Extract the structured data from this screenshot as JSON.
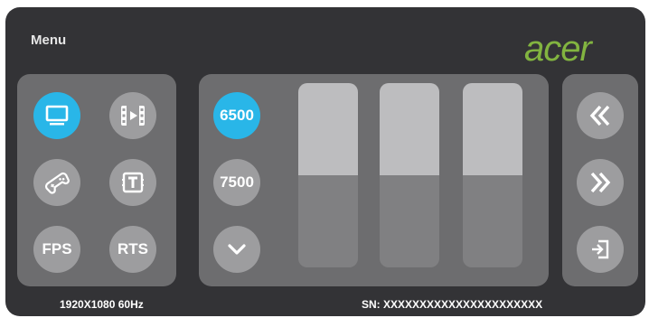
{
  "menu": {
    "title": "Menu",
    "logo": "acer"
  },
  "modes": {
    "items": [
      {
        "icon": "monitor-icon",
        "label": "",
        "active": true
      },
      {
        "icon": "movie-icon",
        "label": "",
        "active": false
      },
      {
        "icon": "gamepad-icon",
        "label": "",
        "active": false
      },
      {
        "icon": "text-mode-icon",
        "label": "",
        "active": false
      },
      {
        "icon": "",
        "label": "FPS",
        "active": false
      },
      {
        "icon": "",
        "label": "RTS",
        "active": false
      }
    ]
  },
  "color_temp": {
    "options": [
      {
        "label": "6500",
        "active": true
      },
      {
        "label": "7500",
        "active": false
      }
    ],
    "more_icon": "chevron-down-icon",
    "sliders": [
      {
        "level": 0.5
      },
      {
        "level": 0.5
      },
      {
        "level": 0.5
      }
    ]
  },
  "navigation": {
    "prev_icon": "double-chevron-left-icon",
    "next_icon": "double-chevron-right-icon",
    "exit_icon": "exit-icon"
  },
  "status": {
    "resolution": "1920X1080  60Hz",
    "serial": "SN: XXXXXXXXXXXXXXXXXXXXXX"
  },
  "colors": {
    "accent": "#29b6e8",
    "brand": "#82b440",
    "panel": "#6d6d6f",
    "background": "#333336"
  }
}
